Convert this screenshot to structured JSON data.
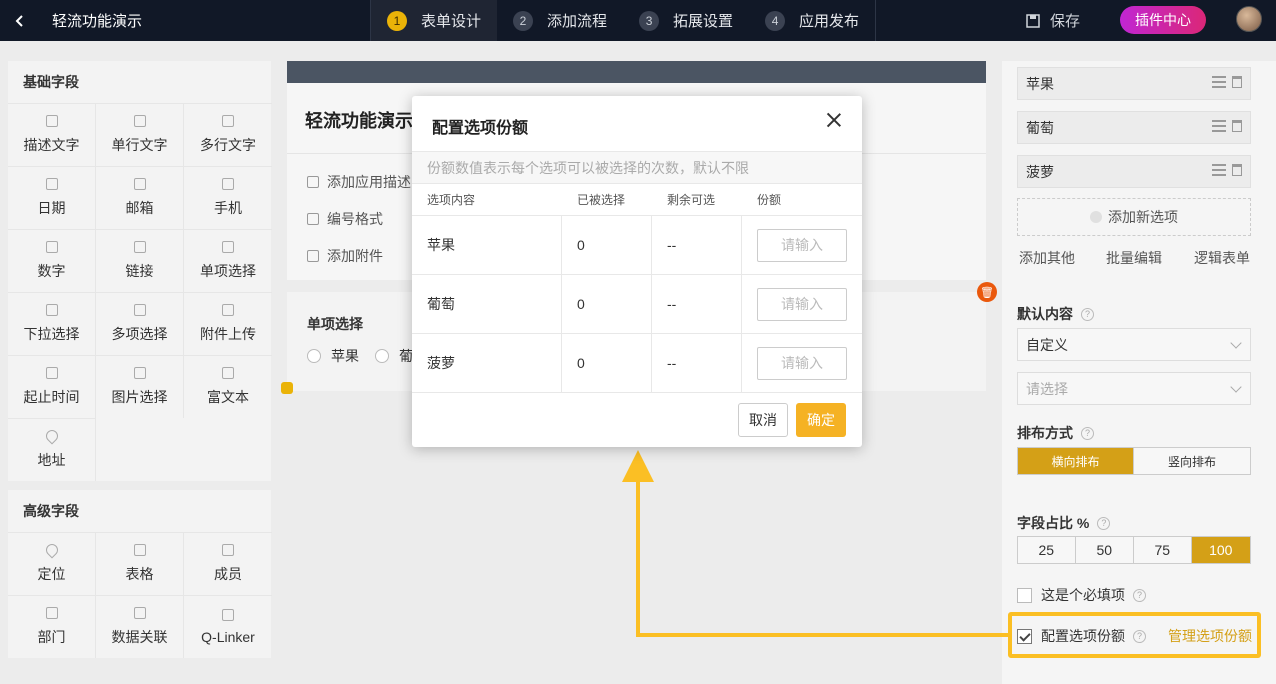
{
  "topbar": {
    "back_icon": "chevron-left-icon",
    "app_title": "轻流功能演示",
    "steps": [
      {
        "num": "1",
        "label": "表单设计"
      },
      {
        "num": "2",
        "label": "添加流程"
      },
      {
        "num": "3",
        "label": "拓展设置"
      },
      {
        "num": "4",
        "label": "应用发布"
      }
    ],
    "save_label": "保存",
    "plugin_label": "插件中心"
  },
  "basic_fields": {
    "title": "基础字段",
    "items": [
      "描述文字",
      "单行文字",
      "多行文字",
      "日期",
      "邮箱",
      "手机",
      "数字",
      "链接",
      "单项选择",
      "下拉选择",
      "多项选择",
      "附件上传",
      "起止时间",
      "图片选择",
      "富文本",
      "地址"
    ]
  },
  "advanced_fields": {
    "title": "高级字段",
    "items": [
      "定位",
      "表格",
      "成员",
      "部门",
      "数据关联",
      "Q-Linker"
    ]
  },
  "canvas": {
    "form_title": "轻流功能演示",
    "add_desc": "添加应用描述",
    "serial_format": "编号格式",
    "add_attachment": "添加附件",
    "single_choice_label": "单项选择",
    "radio_options": [
      "苹果",
      "葡"
    ]
  },
  "modal": {
    "title": "配置选项份额",
    "hint": "份额数值表示每个选项可以被选择的次数，默认不限",
    "columns": [
      "选项内容",
      "已被选择",
      "剩余可选",
      "份额"
    ],
    "rows": [
      {
        "name": "苹果",
        "selected": "0",
        "remaining": "--",
        "placeholder": "请输入"
      },
      {
        "name": "葡萄",
        "selected": "0",
        "remaining": "--",
        "placeholder": "请输入"
      },
      {
        "name": "菠萝",
        "selected": "0",
        "remaining": "--",
        "placeholder": "请输入"
      }
    ],
    "cancel_label": "取消",
    "confirm_label": "确定"
  },
  "right_panel": {
    "options": [
      "苹果",
      "葡萄",
      "菠萝"
    ],
    "add_option": "添加新选项",
    "add_other": "添加其他",
    "batch_edit": "批量编辑",
    "logic_form": "逻辑表单",
    "default_content_label": "默认内容",
    "default_select_value": "自定义",
    "default_select_placeholder": "请选择",
    "layout_label": "排布方式",
    "layout_options": [
      "横向排布",
      "竖向排布"
    ],
    "layout_selected": "横向排布",
    "ratio_label": "字段占比 %",
    "ratio_options": [
      "25",
      "50",
      "75",
      "100"
    ],
    "ratio_selected": "100",
    "required_label": "这是个必填项",
    "required_checked": false,
    "quota_label": "配置选项份额",
    "quota_checked": true,
    "manage_quota": "管理选项份额"
  },
  "colors": {
    "accent": "#f5b224",
    "highlight": "#fbbf24",
    "topbar": "#111827"
  }
}
